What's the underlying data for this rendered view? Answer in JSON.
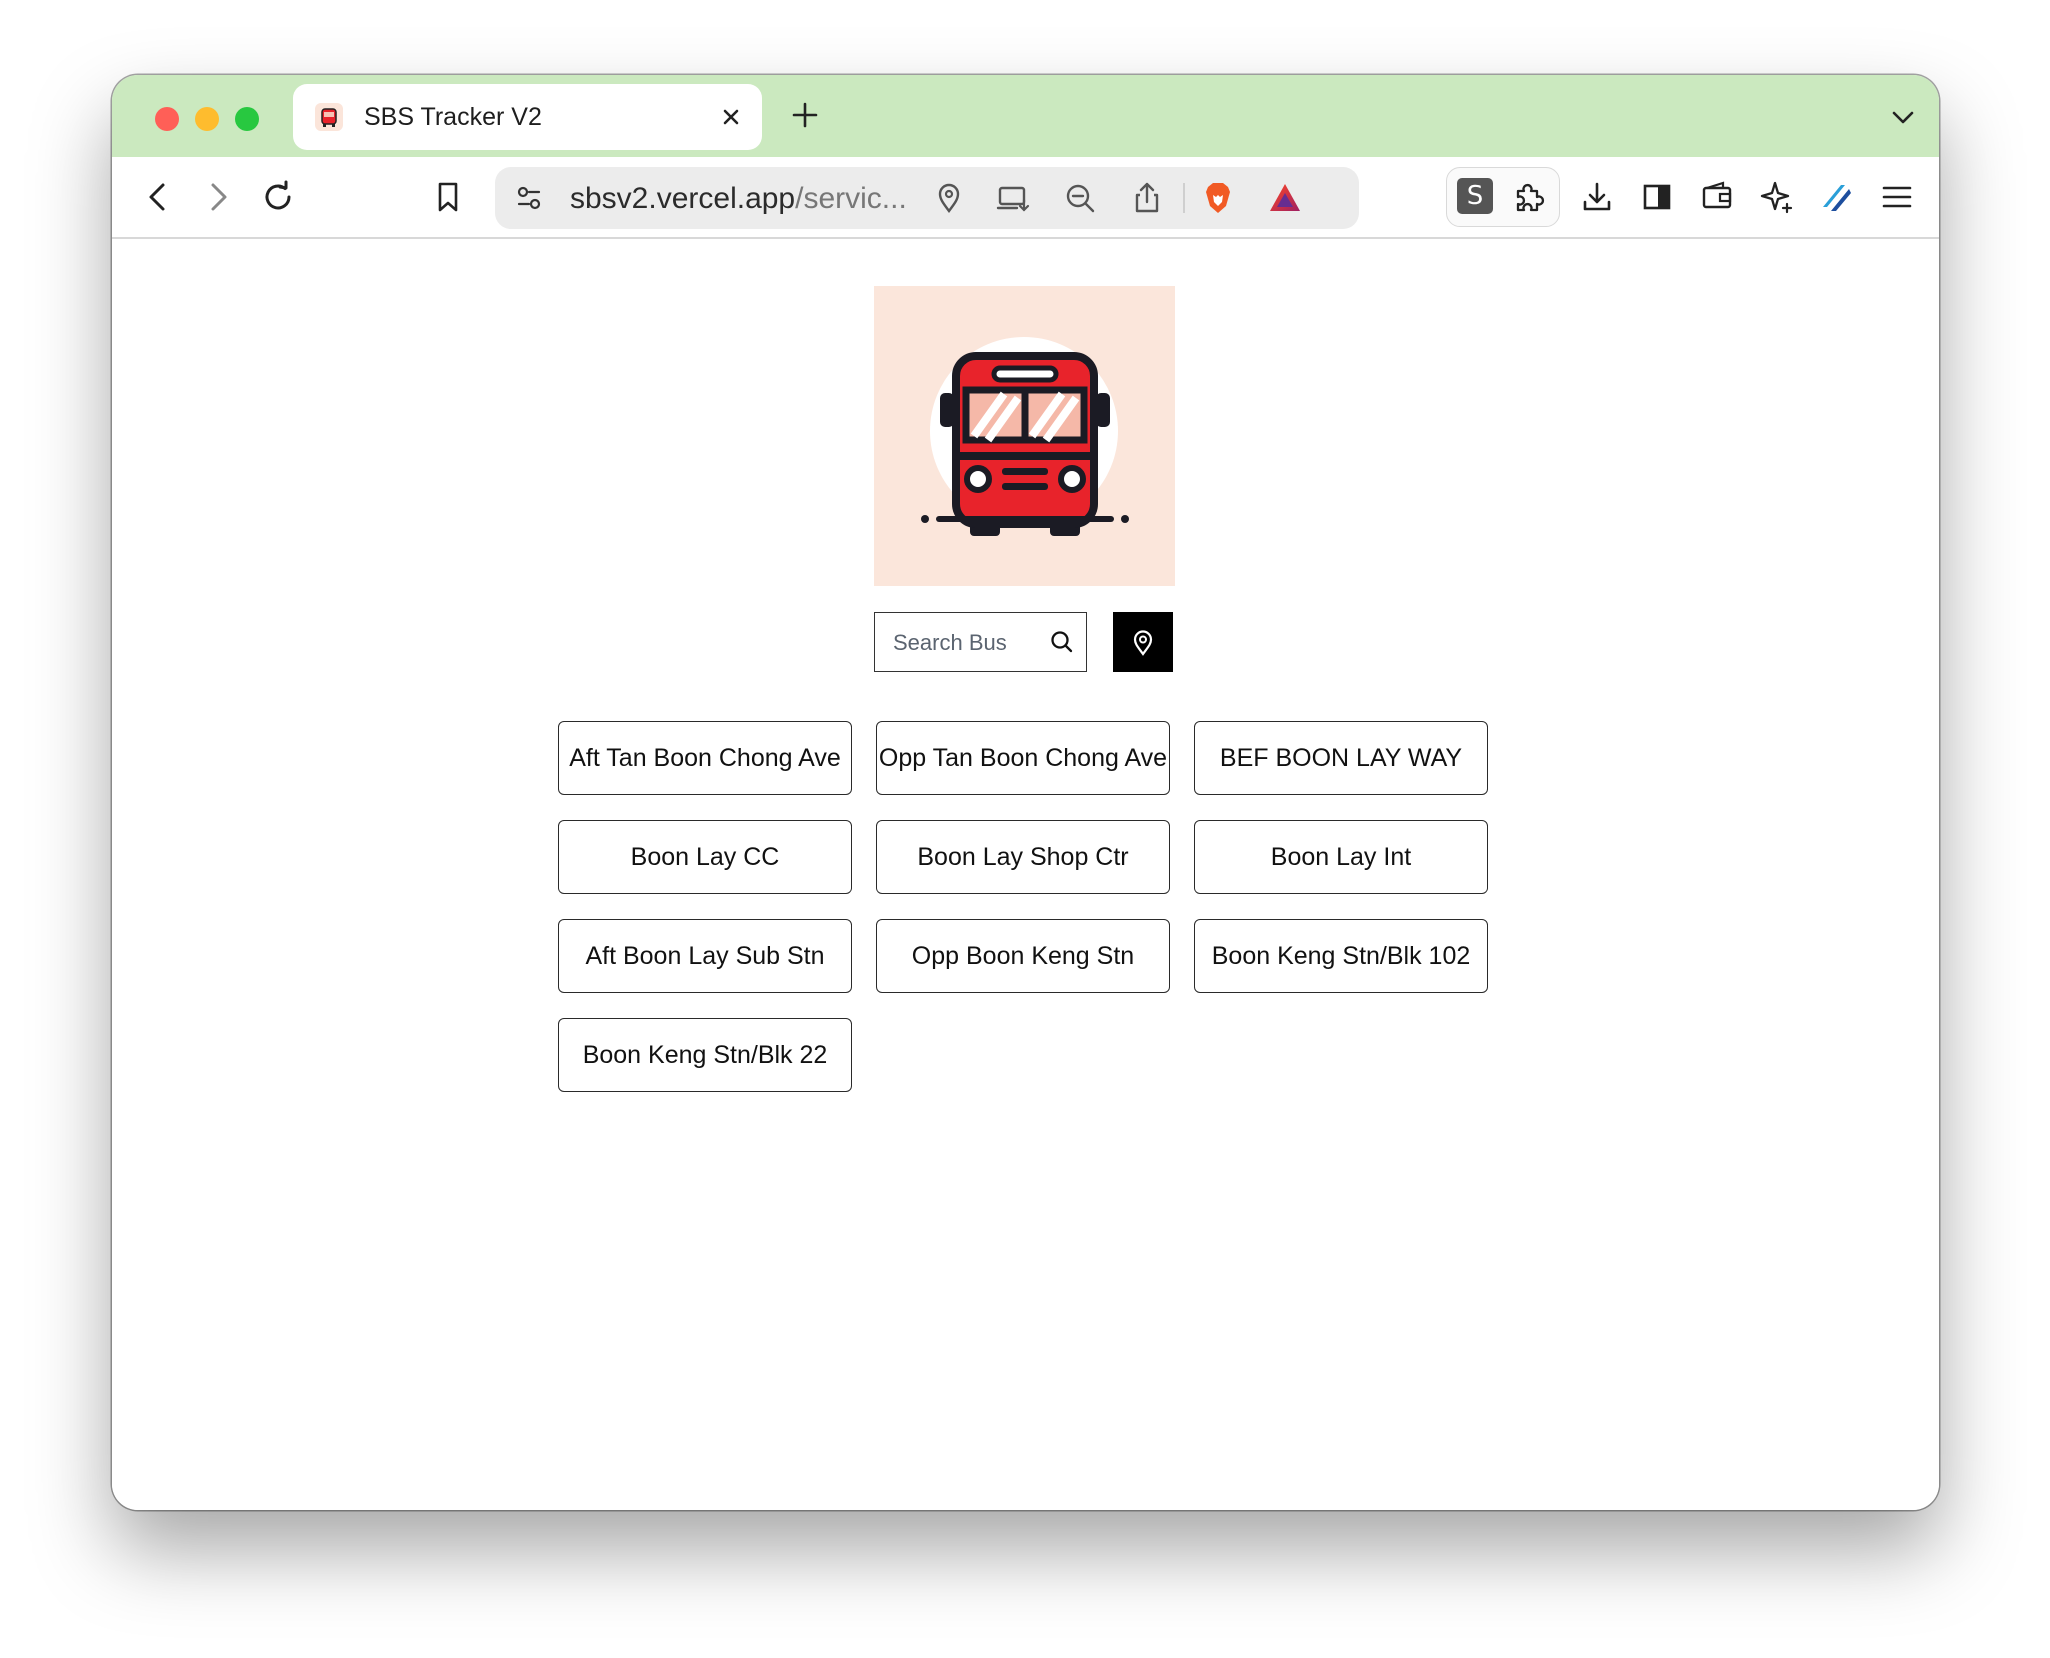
{
  "browser": {
    "tab_title": "SBS Tracker V2",
    "url_host": "sbsv2.vercel.app",
    "url_path": "/servic...",
    "extension_label": "S",
    "colors": {
      "tabbar": "#cbe9bf",
      "brave": "#f15a24"
    }
  },
  "page": {
    "logo_icon": "bus-icon",
    "search": {
      "placeholder": "Search Bus"
    },
    "stops": [
      "Aft Tan Boon Chong Ave",
      "Opp Tan Boon Chong Ave",
      "BEF BOON LAY WAY",
      "Boon Lay CC",
      "Boon Lay Shop Ctr",
      "Boon Lay Int",
      "Aft Boon Lay Sub Stn",
      "Opp Boon Keng Stn",
      "Boon Keng Stn/Blk 102",
      "Boon Keng Stn/Blk 22"
    ]
  }
}
